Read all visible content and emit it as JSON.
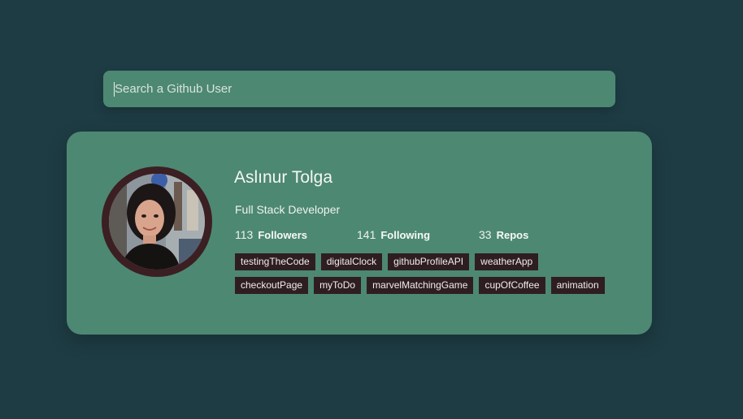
{
  "search": {
    "placeholder": "Search a Github User",
    "value": ""
  },
  "profile": {
    "name": "Aslınur Tolga",
    "bio": "Full Stack Developer",
    "avatar_alt": "avatar-photo"
  },
  "stats": {
    "followers": {
      "count": "113",
      "label": "Followers"
    },
    "following": {
      "count": "141",
      "label": "Following"
    },
    "repos": {
      "count": "33",
      "label": "Repos"
    }
  },
  "repos": [
    "testingTheCode",
    "digitalClock",
    "githubProfileAPI",
    "weatherApp",
    "checkoutPage",
    "myToDo",
    "marvelMatchingGame",
    "cupOfCoffee",
    "animation"
  ],
  "colors": {
    "background": "#1e3c44",
    "card": "#4d8872",
    "repo_tag": "#2f1e21",
    "avatar_ring": "#3b1f22"
  }
}
